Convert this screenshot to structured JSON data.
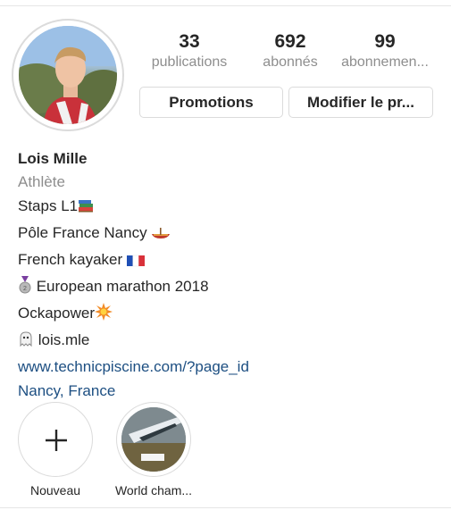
{
  "stats": [
    {
      "count": "33",
      "label": "publications"
    },
    {
      "count": "692",
      "label": "abonnés"
    },
    {
      "count": "99",
      "label": "abonnemen..."
    }
  ],
  "buttons": {
    "promotions": "Promotions",
    "edit_profile": "Modifier le pr..."
  },
  "profile": {
    "name": "Lois Mille",
    "category": "Athlète",
    "bio_lines": [
      {
        "text": "Staps L1",
        "icon": "books-emoji"
      },
      {
        "text": "Pôle France Nancy ",
        "icon": "canoe-emoji"
      },
      {
        "text": "French kayaker ",
        "icon": "france-flag-emoji"
      },
      {
        "text": " European marathon 2018",
        "icon": "silver-medal-emoji"
      },
      {
        "text": "Ockapower",
        "icon": "collision-emoji"
      },
      {
        "text": " lois.mle",
        "icon": "snapchat-ghost-emoji"
      }
    ],
    "website": "www.technicpiscine.com/?page_id",
    "location": "Nancy, France"
  },
  "highlights": [
    {
      "label": "Nouveau",
      "icon": "plus-icon"
    },
    {
      "label": "World cham..."
    }
  ],
  "colors": {
    "link": "#1d4f82",
    "muted": "#8e8e8e",
    "border": "#dbdbdb",
    "text": "#262626"
  }
}
